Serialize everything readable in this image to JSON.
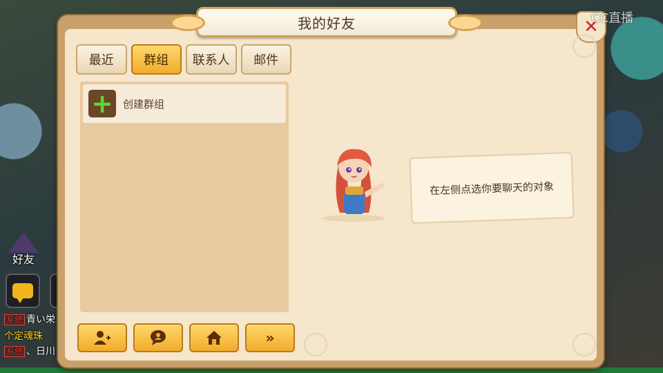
{
  "dialog": {
    "title": "我的好友",
    "close_icon": "close-icon"
  },
  "tabs": [
    {
      "label": "最近",
      "active": false
    },
    {
      "label": "群组",
      "active": true
    },
    {
      "label": "联系人",
      "active": false
    },
    {
      "label": "邮件",
      "active": false
    }
  ],
  "group_list": {
    "create_label": "创建群组"
  },
  "bottom_buttons": [
    {
      "icon": "add-user-icon"
    },
    {
      "icon": "chat-icon"
    },
    {
      "icon": "home-icon"
    },
    {
      "icon": "double-chevron-right-icon"
    }
  ],
  "chat_panel": {
    "hint": "在左侧点选你要聊天的对象"
  },
  "hud": {
    "friends_label": "好友",
    "lines": [
      {
        "tag": "系统",
        "text": "青い栄"
      },
      {
        "tag": "",
        "text": "个定魂珠"
      },
      {
        "tag": "系统",
        "text": "、日川"
      }
    ]
  },
  "watermark": "CC直播",
  "colors": {
    "accent_gold": "#f1ac2c",
    "panel_bg": "#f5e6cc",
    "close_red": "#d0262b",
    "plus_green": "#5bd633"
  }
}
